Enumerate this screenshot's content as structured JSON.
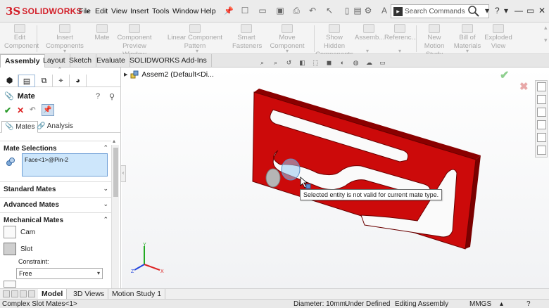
{
  "app": {
    "logo_mark": "3S",
    "logo_text": "SOLIDWORKS",
    "menu": [
      "File",
      "Edit",
      "View",
      "Insert",
      "Tools",
      "Window",
      "Help"
    ],
    "search_placeholder": "Search Commands",
    "accent": "#d3202a"
  },
  "ribbon": {
    "buttons": [
      {
        "label_1": "Edit",
        "label_2": "Component"
      },
      {
        "label_1": "Insert Components",
        "label_2": ""
      },
      {
        "label_1": "Mate",
        "label_2": ""
      },
      {
        "label_1": "Component",
        "label_2": "Preview Window"
      },
      {
        "label_1": "Linear Component Pattern",
        "label_2": ""
      },
      {
        "label_1": "Smart",
        "label_2": "Fasteners"
      },
      {
        "label_1": "Move Component",
        "label_2": ""
      },
      {
        "label_1": "Show Hidden",
        "label_2": "Components"
      },
      {
        "label_1": "Assemb...",
        "label_2": ""
      },
      {
        "label_1": "Referenc...",
        "label_2": ""
      },
      {
        "label_1": "New Motion",
        "label_2": "Study"
      },
      {
        "label_1": "Bill of",
        "label_2": "Materials"
      },
      {
        "label_1": "Exploded",
        "label_2": "View"
      }
    ]
  },
  "tabs": [
    "Assembly",
    "Layout",
    "Sketch",
    "Evaluate",
    "SOLIDWORKS Add-Ins"
  ],
  "panel": {
    "title": "Mate",
    "subtabs": [
      "Mates",
      "Analysis"
    ],
    "sections": {
      "mate_selections": "Mate Selections",
      "standard": "Standard Mates",
      "advanced": "Advanced Mates",
      "mechanical": "Mechanical Mates"
    },
    "selection": "Face<1>@Pin-2",
    "mech_items": [
      {
        "label": "Cam",
        "icon": "cam-icon"
      },
      {
        "label": "Slot",
        "icon": "slot-icon"
      }
    ],
    "constraint_label": "Constraint:",
    "constraint_value": "Free"
  },
  "graphics": {
    "tree_item": "Assem2  (Default<Di...",
    "tooltip": "Selected entity is not valid for current mate type.",
    "part_color": "#cc0a0a"
  },
  "bottom_tabs": [
    "Model",
    "3D Views",
    "Motion Study 1"
  ],
  "status": {
    "left": "Complex Slot Mates<1>",
    "diameter": "Diameter: 10mm",
    "state": "Under Defined",
    "mode": "Editing Assembly",
    "units": "MMGS"
  }
}
